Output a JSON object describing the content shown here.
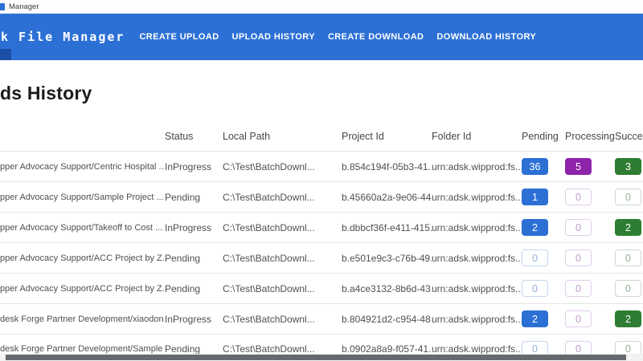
{
  "window": {
    "title": "Manager"
  },
  "appbar": {
    "brand": "k File Manager",
    "nav": [
      {
        "label": "CREATE UPLOAD"
      },
      {
        "label": "UPLOAD HISTORY"
      },
      {
        "label": "CREATE DOWNLOAD"
      },
      {
        "label": "DOWNLOAD HISTORY"
      }
    ]
  },
  "page": {
    "title": "ds History"
  },
  "table": {
    "columns": [
      "",
      "Status",
      "Local Path",
      "Project Id",
      "Folder Id",
      "Pending",
      "Processing",
      "Succeeded"
    ],
    "rows": [
      {
        "name": "pper Advocacy Support/Centric Hospital ...",
        "status": "InProgress",
        "local_path": "C:\\Test\\BatchDownl...",
        "project_id": "b.854c194f-05b3-41...",
        "folder_id": "urn:adsk.wipprod:fs...",
        "pending": "36",
        "processing": "5",
        "succeeded": "3"
      },
      {
        "name": "pper Advocacy Support/Sample Project ...",
        "status": "Pending",
        "local_path": "C:\\Test\\BatchDownl...",
        "project_id": "b.45660a2a-9e06-44...",
        "folder_id": "urn:adsk.wipprod:fs...",
        "pending": "1",
        "processing": "0",
        "succeeded": "0"
      },
      {
        "name": "pper Advocacy Support/Takeoff to Cost ...",
        "status": "InProgress",
        "local_path": "C:\\Test\\BatchDownl...",
        "project_id": "b.dbbcf36f-e411-415...",
        "folder_id": "urn:adsk.wipprod:fs...",
        "pending": "2",
        "processing": "0",
        "succeeded": "2"
      },
      {
        "name": "pper Advocacy Support/ACC Project by Z...",
        "status": "Pending",
        "local_path": "C:\\Test\\BatchDownl...",
        "project_id": "b.e501e9c3-c76b-49...",
        "folder_id": "urn:adsk.wipprod:fs...",
        "pending": "0",
        "processing": "0",
        "succeeded": "0"
      },
      {
        "name": "pper Advocacy Support/ACC Project by Z...",
        "status": "Pending",
        "local_path": "C:\\Test\\BatchDownl...",
        "project_id": "b.a4ce3132-8b6d-43...",
        "folder_id": "urn:adsk.wipprod:fs...",
        "pending": "0",
        "processing": "0",
        "succeeded": "0"
      },
      {
        "name": "desk Forge Partner Development/xiaodon...",
        "status": "InProgress",
        "local_path": "C:\\Test\\BatchDownl...",
        "project_id": "b.804921d2-c954-48...",
        "folder_id": "urn:adsk.wipprod:fs...",
        "pending": "2",
        "processing": "0",
        "succeeded": "2"
      },
      {
        "name": "desk Forge Partner Development/Sample ...",
        "status": "Pending",
        "local_path": "C:\\Test\\BatchDownl...",
        "project_id": "b.0902a8a9-f057-41...",
        "folder_id": "urn:adsk.wipprod:fs...",
        "pending": "0",
        "processing": "0",
        "succeeded": "0"
      }
    ]
  },
  "colors": {
    "appbar_blue": "#2c70d6",
    "pending_blue": "#2c70d6",
    "processing_purple": "#8e24aa",
    "succeeded_green": "#2e7d32",
    "corner_dark_blue": "#1b4ea6"
  }
}
